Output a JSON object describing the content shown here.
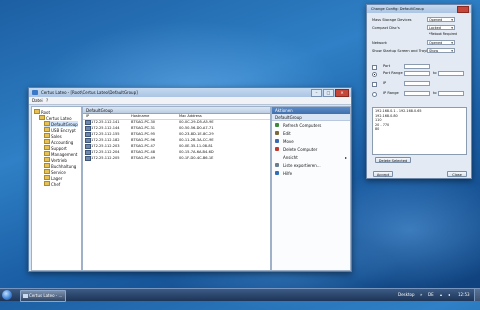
{
  "main_window": {
    "title": "Certus Lateo - [Root\\Certus Lateo\\DefaultGroup]",
    "menu": [
      "Datei",
      "?"
    ],
    "tree": [
      {
        "label": "Root",
        "depth": 0
      },
      {
        "label": "Certus Lateo",
        "depth": 1
      },
      {
        "label": "DefaultGroup",
        "depth": 2,
        "selected": true
      },
      {
        "label": "USB Encrypt",
        "depth": 2
      },
      {
        "label": "Sales",
        "depth": 2
      },
      {
        "label": "Accounting",
        "depth": 2
      },
      {
        "label": "Support",
        "depth": 2
      },
      {
        "label": "Management",
        "depth": 2
      },
      {
        "label": "Vertrieb",
        "depth": 2
      },
      {
        "label": "Buchhaltung",
        "depth": 2
      },
      {
        "label": "Service",
        "depth": 2
      },
      {
        "label": "Lager",
        "depth": 2
      },
      {
        "label": "Chef",
        "depth": 2
      }
    ],
    "list": {
      "header": "DefaultGroup",
      "columns": [
        "IP",
        "Hostname",
        "Mac Address"
      ],
      "rows": [
        [
          "172.25.112.141",
          "BTSAG-PC-30",
          "00-0C-29-D5-A5-9E"
        ],
        [
          "172.25.112.144",
          "BTSAG-PC-31",
          "00-50-56-D0-A7-71"
        ],
        [
          "172.25.112.155",
          "BTSAG-PC-95",
          "00-23-8D-1E-8C-29"
        ],
        [
          "172.25.112.182",
          "BTSAG-PC-96",
          "00-11-2B-3A-CC-9E"
        ],
        [
          "172.25.112.203",
          "BTSAG-PC-47",
          "00-0E-35-11-08-81"
        ],
        [
          "172.25.112.204",
          "BTSAG-PC-48",
          "00-15-7A-6A-B4-6D"
        ],
        [
          "172.25.112.205",
          "BTSAG-PC-49",
          "00-1F-D0-4C-B6-1E"
        ]
      ]
    },
    "actions": {
      "title": "Aktionen",
      "group": "DefaultGroup",
      "items": [
        {
          "label": "Refresh Computers",
          "icon": "refresh-icon",
          "color": "#3d8a3a"
        },
        {
          "label": "Edit",
          "icon": "edit-icon",
          "color": "#7d6a3a"
        },
        {
          "label": "Move",
          "icon": "move-icon",
          "color": "#3a6ab0"
        },
        {
          "label": "Delete Computer",
          "icon": "delete-icon",
          "color": "#c0392b"
        },
        {
          "label": "Ansicht",
          "icon": "",
          "color": "",
          "submenu": true
        },
        {
          "label": "Liste exportieren...",
          "icon": "export-icon",
          "color": "#6a7d93"
        },
        {
          "label": "Hilfe",
          "icon": "help-icon",
          "color": "#2f6fb8"
        }
      ]
    }
  },
  "dialog": {
    "title": "Change Config: DefaultGroup",
    "mass_storage_label": "Mass Storage Devices",
    "mass_storage_value": "Opened",
    "compact_discs_label": "Compact Disc's",
    "compact_discs_value": "Locked",
    "reboot_note": "*Reboot Required",
    "network_label": "Network",
    "network_value": "Opened",
    "startup_label": "Show Startup Screen and Trayicon",
    "startup_value": "Show",
    "port_label": "Port",
    "port_range_label": "Port Range",
    "ip_label": "IP",
    "ip_range_label": "IP Range",
    "to_label": "to",
    "ranges": [
      "192.168.0.1 - 192.168.0.65",
      "192.168.0.80",
      "110",
      "20 - 770",
      "80"
    ],
    "delete_button": "Delete Selected",
    "accept_button": "Accept",
    "close_button": "Close"
  },
  "taskbar": {
    "task_label": "Certus Lateo - ...",
    "desktop_label": "Desktop",
    "lang": "DE",
    "time": "12:53"
  }
}
